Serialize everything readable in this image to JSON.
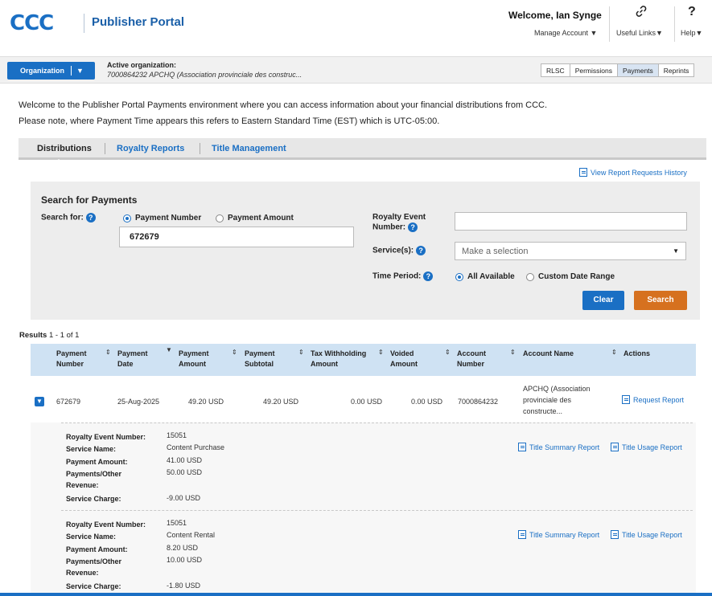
{
  "header": {
    "logo": "CCC",
    "portal_name": "Publisher Portal",
    "welcome": "Welcome, Ian Synge",
    "manage_account": "Manage Account ▼",
    "useful_links": "Useful Links▼",
    "help_symbol": "?",
    "help": "Help▼",
    "links_icon": "link-icon"
  },
  "org": {
    "button_label": "Organization",
    "active_label": "Active organization:",
    "active_value": "7000864232 APCHQ (Association provinciale des construc...",
    "subtabs": [
      "RLSC",
      "Permissions",
      "Payments",
      "Reprints"
    ],
    "active_subtab": "Payments"
  },
  "intro": {
    "line1": "Welcome to the Publisher Portal Payments environment where you can access information about your financial distributions from CCC.",
    "line2": "Please note, where Payment Time appears this refers to Eastern Standard Time (EST) which is UTC-05:00."
  },
  "tabs": [
    "Distributions",
    "Royalty Reports",
    "Title Management"
  ],
  "view_history": "View Report Requests History",
  "search": {
    "title": "Search for Payments",
    "search_for_label": "Search for:",
    "radio_payment_number": "Payment Number",
    "radio_payment_amount": "Payment Amount",
    "payment_value": "672679",
    "royalty_event_label_1": "Royalty Event",
    "royalty_event_label_2": "Number:",
    "royalty_event_value": "",
    "services_label": "Service(s):",
    "services_placeholder": "Make a selection",
    "time_period_label": "Time Period:",
    "radio_all": "All Available",
    "radio_custom": "Custom Date Range",
    "clear": "Clear",
    "search_btn": "Search"
  },
  "results": {
    "prefix": "Results",
    "range": "1 - 1 of 1",
    "columns": {
      "c1a": "Payment",
      "c1b": "Number",
      "c2a": "Payment",
      "c2b": "Date",
      "c3a": "Payment",
      "c3b": "Amount",
      "c4a": "Payment",
      "c4b": "Subtotal",
      "c5a": "Tax Withholding",
      "c5b": "Amount",
      "c6a": "Voided",
      "c6b": "Amount",
      "c7a": "Account",
      "c7b": "Number",
      "c8": "Account Name",
      "c9": "Actions"
    },
    "row": {
      "payment_number": "672679",
      "payment_date": "25-Aug-2025",
      "payment_amount": "49.20 USD",
      "payment_subtotal": "49.20 USD",
      "tax": "0.00 USD",
      "voided": "0.00 USD",
      "account_number": "7000864232",
      "account_name_1": "APCHQ (Association",
      "account_name_2": "provinciale des",
      "account_name_3": "constructe...",
      "action": "Request Report"
    },
    "details": [
      {
        "k_event": "Royalty Event Number:",
        "v_event": "15051",
        "k_service": "Service Name:",
        "v_service": "Content Purchase",
        "k_amount": "Payment Amount:",
        "v_amount": "41.00 USD",
        "k_rev1": "Payments/Other",
        "k_rev2": "Revenue:",
        "v_rev": "50.00 USD",
        "k_charge": "Service Charge:",
        "v_charge": "-9.00 USD",
        "summary": "Title Summary Report",
        "usage": "Title Usage Report"
      },
      {
        "k_event": "Royalty Event Number:",
        "v_event": "15051",
        "k_service": "Service Name:",
        "v_service": "Content Rental",
        "k_amount": "Payment Amount:",
        "v_amount": "8.20 USD",
        "k_rev1": "Payments/Other",
        "k_rev2": "Revenue:",
        "v_rev": "10.00 USD",
        "k_charge": "Service Charge:",
        "v_charge": "-1.80 USD",
        "summary": "Title Summary Report",
        "usage": "Title Usage Report"
      }
    ]
  },
  "colors": {
    "brand_blue": "#1a6fc4",
    "search_orange": "#d6711f",
    "table_header": "#cfe2f3"
  }
}
